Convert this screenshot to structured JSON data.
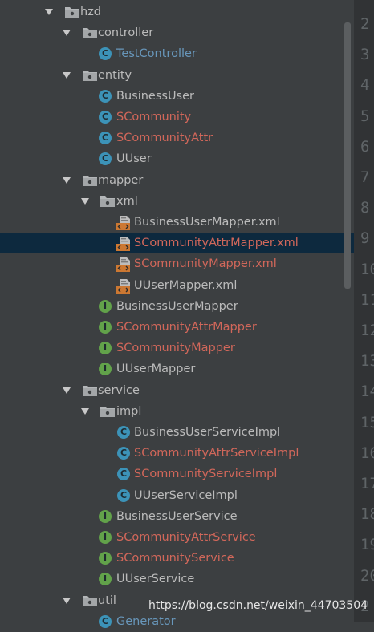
{
  "tree": [
    {
      "label": "hzd",
      "kind": "package",
      "depth": 0,
      "expanded": true
    },
    {
      "label": "controller",
      "kind": "package",
      "depth": 1,
      "expanded": true
    },
    {
      "label": "TestController",
      "kind": "class",
      "depth": 2,
      "vcs": "modified"
    },
    {
      "label": "entity",
      "kind": "package",
      "depth": 1,
      "expanded": true
    },
    {
      "label": "BusinessUser",
      "kind": "class",
      "depth": 2,
      "vcs": "normal"
    },
    {
      "label": "SCommunity",
      "kind": "class",
      "depth": 2,
      "vcs": "unversioned"
    },
    {
      "label": "SCommunityAttr",
      "kind": "class",
      "depth": 2,
      "vcs": "unversioned"
    },
    {
      "label": "UUser",
      "kind": "class",
      "depth": 2,
      "vcs": "normal"
    },
    {
      "label": "mapper",
      "kind": "package",
      "depth": 1,
      "expanded": true
    },
    {
      "label": "xml",
      "kind": "package",
      "depth": 2,
      "expanded": true
    },
    {
      "label": "BusinessUserMapper.xml",
      "kind": "xml",
      "depth": 3,
      "vcs": "normal"
    },
    {
      "label": "SCommunityAttrMapper.xml",
      "kind": "xml",
      "depth": 3,
      "vcs": "unversioned",
      "selected": true
    },
    {
      "label": "SCommunityMapper.xml",
      "kind": "xml",
      "depth": 3,
      "vcs": "unversioned"
    },
    {
      "label": "UUserMapper.xml",
      "kind": "xml",
      "depth": 3,
      "vcs": "normal"
    },
    {
      "label": "BusinessUserMapper",
      "kind": "interface",
      "depth": 2,
      "vcs": "normal"
    },
    {
      "label": "SCommunityAttrMapper",
      "kind": "interface",
      "depth": 2,
      "vcs": "unversioned"
    },
    {
      "label": "SCommunityMapper",
      "kind": "interface",
      "depth": 2,
      "vcs": "unversioned"
    },
    {
      "label": "UUserMapper",
      "kind": "interface",
      "depth": 2,
      "vcs": "normal"
    },
    {
      "label": "service",
      "kind": "package",
      "depth": 1,
      "expanded": true
    },
    {
      "label": "impl",
      "kind": "package",
      "depth": 2,
      "expanded": true
    },
    {
      "label": "BusinessUserServiceImpl",
      "kind": "class",
      "depth": 3,
      "vcs": "normal"
    },
    {
      "label": "SCommunityAttrServiceImpl",
      "kind": "class",
      "depth": 3,
      "vcs": "unversioned"
    },
    {
      "label": "SCommunityServiceImpl",
      "kind": "class",
      "depth": 3,
      "vcs": "unversioned"
    },
    {
      "label": "UUserServiceImpl",
      "kind": "class",
      "depth": 3,
      "vcs": "normal"
    },
    {
      "label": "BusinessUserService",
      "kind": "interface",
      "depth": 2,
      "vcs": "normal"
    },
    {
      "label": "SCommunityAttrService",
      "kind": "interface",
      "depth": 2,
      "vcs": "unversioned"
    },
    {
      "label": "SCommunityService",
      "kind": "interface",
      "depth": 2,
      "vcs": "unversioned"
    },
    {
      "label": "UUserService",
      "kind": "interface",
      "depth": 2,
      "vcs": "normal"
    },
    {
      "label": "util",
      "kind": "package",
      "depth": 1,
      "expanded": true
    },
    {
      "label": "Generator",
      "kind": "class",
      "depth": 2,
      "vcs": "modified"
    }
  ],
  "line_numbers": [
    "2",
    "3",
    "4",
    "5",
    "6",
    "7",
    "8",
    "9",
    "10",
    "11",
    "12",
    "13",
    "14",
    "15",
    "16",
    "17",
    "18",
    "19",
    "20",
    "2"
  ],
  "watermark": "https://blog.csdn.net/weixin_44703504",
  "icon_letters": {
    "class": "C",
    "interface": "I"
  },
  "colors": {
    "background": "#3c3f41",
    "gutter": "#313335",
    "selection": "#0d293e",
    "text_normal": "#bbbbbb",
    "text_modified": "#6897bb",
    "text_unversioned": "#d1675a",
    "class_icon": "#3c93b8",
    "interface_icon": "#62a24a",
    "xml_icon": "#cc7832"
  }
}
